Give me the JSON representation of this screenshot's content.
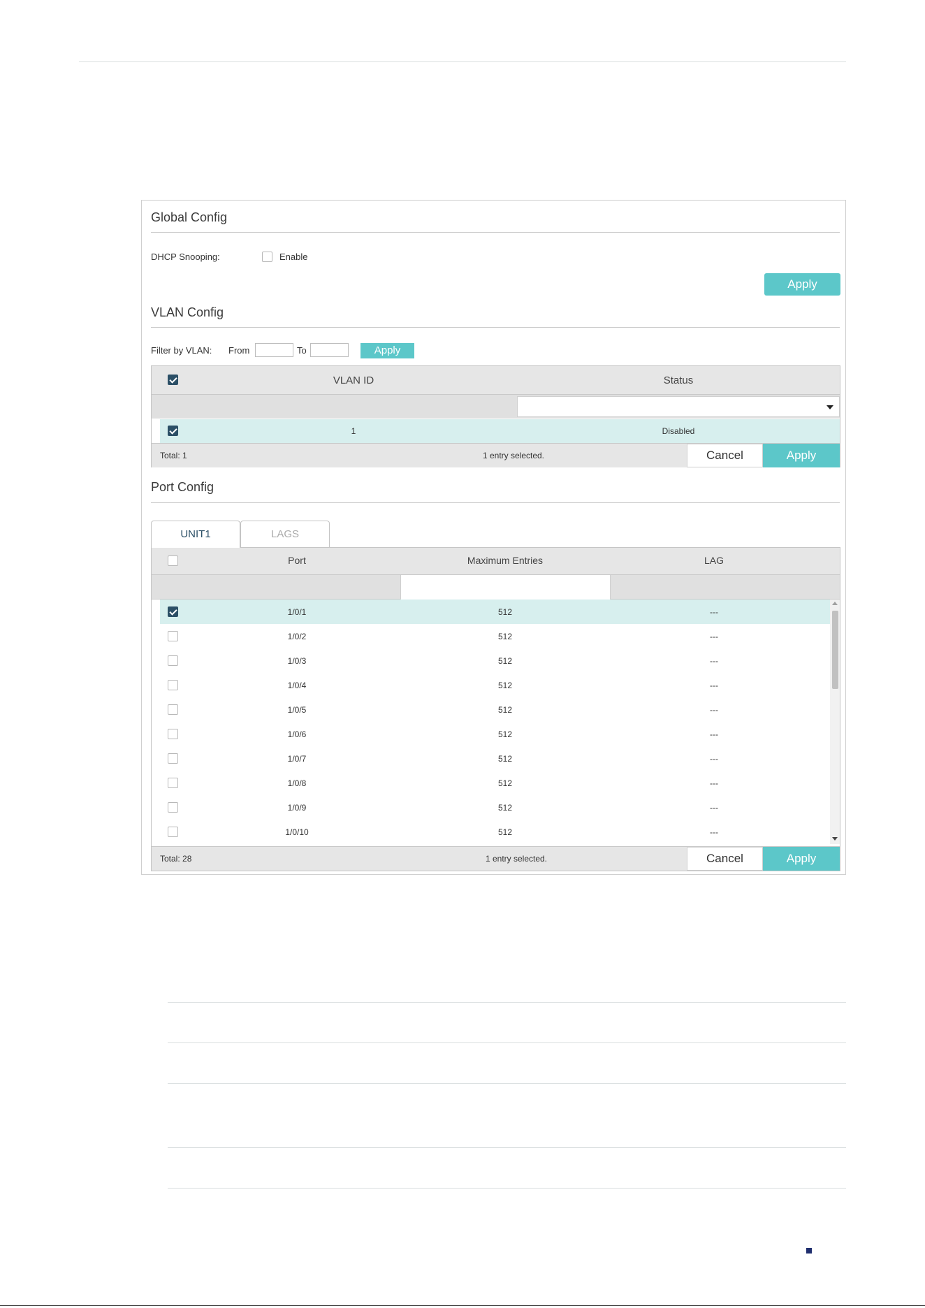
{
  "global_config": {
    "title": "Global Config",
    "dhcp_label": "DHCP Snooping:",
    "enable_label": "Enable",
    "enable_checked": false,
    "apply_label": "Apply"
  },
  "vlan_config": {
    "title": "VLAN Config",
    "filter_label": "Filter by VLAN:",
    "from_label": "From",
    "to_label": "To",
    "from_value": "",
    "to_value": "",
    "filter_apply_label": "Apply",
    "columns": {
      "vlan_id": "VLAN ID",
      "status": "Status"
    },
    "rows": [
      {
        "checked": true,
        "vlan_id": "1",
        "status": "Disabled"
      }
    ],
    "total": "Total: 1",
    "selected_text": "1 entry selected.",
    "cancel_label": "Cancel",
    "apply_label": "Apply"
  },
  "port_config": {
    "title": "Port Config",
    "tabs": [
      {
        "label": "UNIT1",
        "active": true
      },
      {
        "label": "LAGS",
        "active": false
      }
    ],
    "columns": {
      "port": "Port",
      "max_entries": "Maximum Entries",
      "lag": "LAG"
    },
    "rows": [
      {
        "checked": true,
        "port": "1/0/1",
        "max": "512",
        "lag": "---"
      },
      {
        "checked": false,
        "port": "1/0/2",
        "max": "512",
        "lag": "---"
      },
      {
        "checked": false,
        "port": "1/0/3",
        "max": "512",
        "lag": "---"
      },
      {
        "checked": false,
        "port": "1/0/4",
        "max": "512",
        "lag": "---"
      },
      {
        "checked": false,
        "port": "1/0/5",
        "max": "512",
        "lag": "---"
      },
      {
        "checked": false,
        "port": "1/0/6",
        "max": "512",
        "lag": "---"
      },
      {
        "checked": false,
        "port": "1/0/7",
        "max": "512",
        "lag": "---"
      },
      {
        "checked": false,
        "port": "1/0/8",
        "max": "512",
        "lag": "---"
      },
      {
        "checked": false,
        "port": "1/0/9",
        "max": "512",
        "lag": "---"
      },
      {
        "checked": false,
        "port": "1/0/10",
        "max": "512",
        "lag": "---"
      }
    ],
    "total": "Total: 28",
    "selected_text": "1 entry selected.",
    "cancel_label": "Cancel",
    "apply_label": "Apply"
  }
}
